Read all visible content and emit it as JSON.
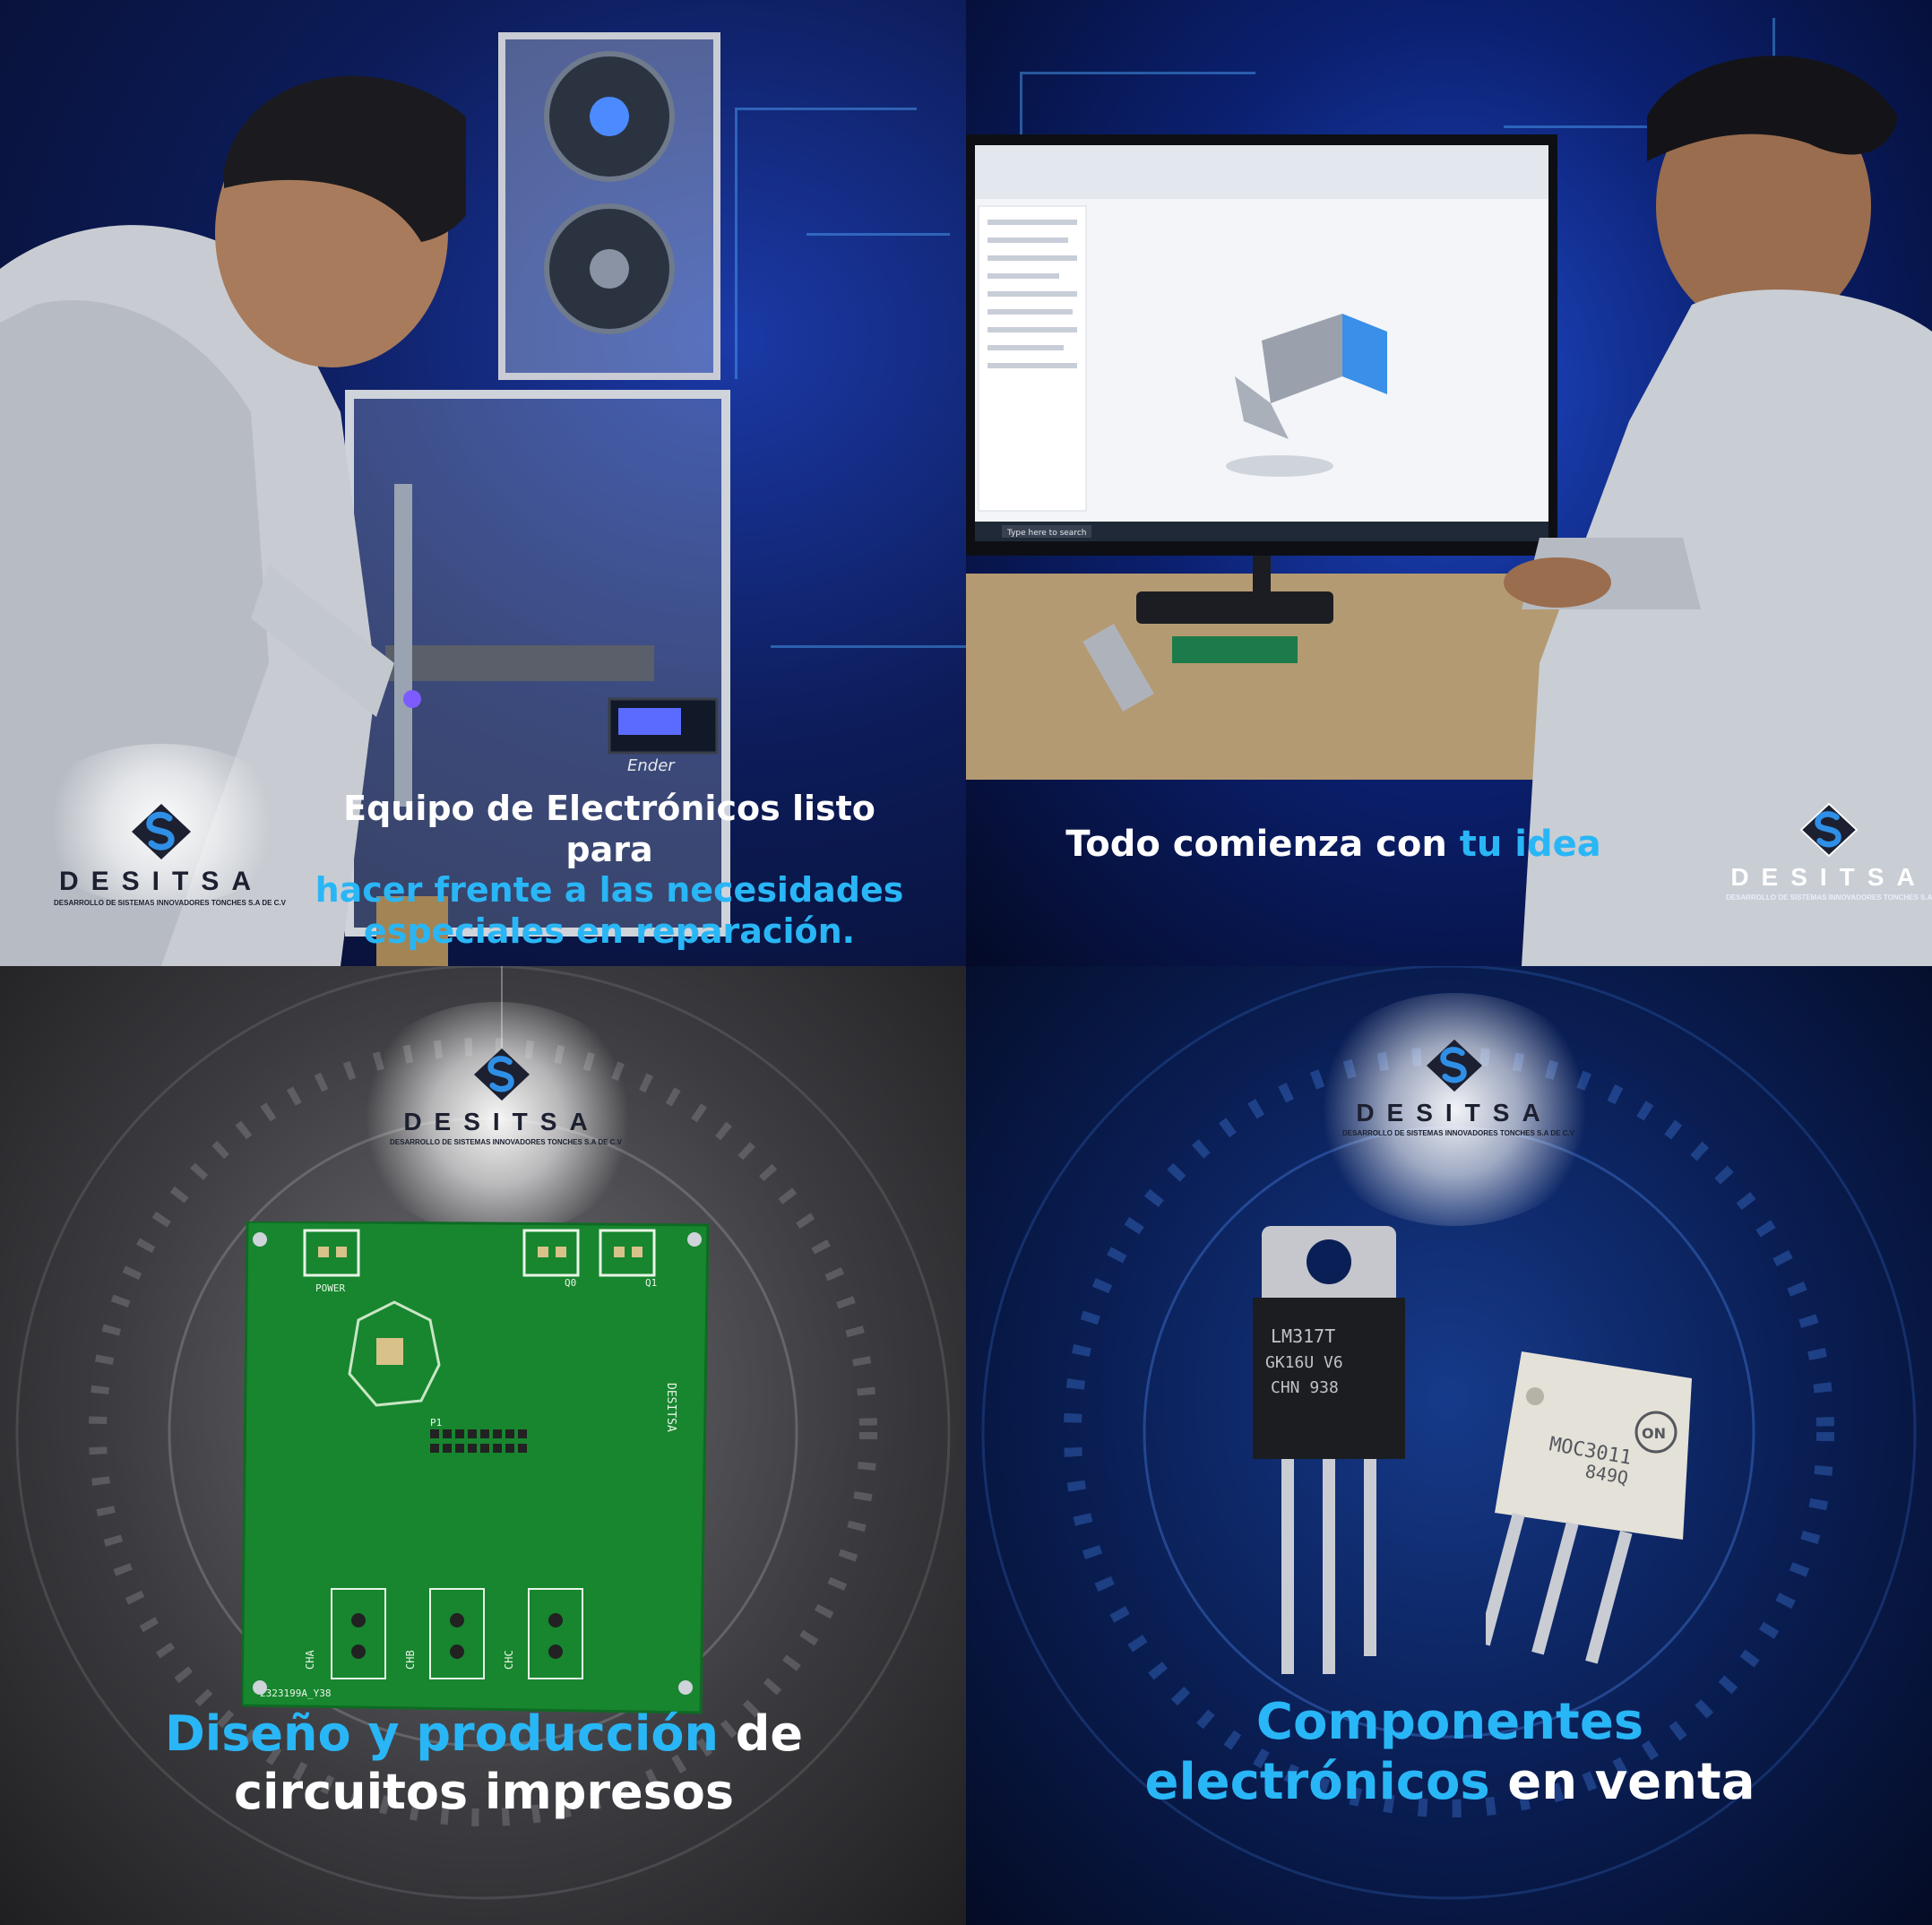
{
  "brand": {
    "name": "DESITSA",
    "tagline": "DESARROLLO DE SISTEMAS INNOVADORES TONCHES S.A DE C.V",
    "colors": {
      "accent": "#29b6f6",
      "text_light": "#ffffff",
      "logo_dark": "#1c2030"
    }
  },
  "panels": {
    "p1": {
      "caption_white_1": "Equipo de Electrónicos listo para",
      "caption_blue_2": "hacer frente a las necesidades",
      "caption_blue_3": "especiales en reparación.",
      "printer_brand": "Ender"
    },
    "p2": {
      "caption_white": "Todo comienza con ",
      "caption_blue": "tu idea",
      "taskbar_search": "Type here to search"
    },
    "p3": {
      "caption_blue": "Diseño y producción",
      "caption_white_1": " de",
      "caption_white_2": "circuitos impresos",
      "pcb": {
        "silk_power": "POWER",
        "silk_brand": "DESITSA",
        "silk_cha": "CHA",
        "silk_chb": "CHB",
        "silk_chc": "CHC",
        "silk_code": "2323199A_Y38",
        "silk_q0": "Q0",
        "silk_q1": "Q1",
        "silk_p1": "P1"
      }
    },
    "p4": {
      "caption_blue_1": "Componentes",
      "caption_blue_2": "electrónicos",
      "caption_white_2": " en venta",
      "regulator_lines": [
        "LM317T",
        "GK16U V6",
        "CHN 938"
      ],
      "opto_lines": [
        "MOC3011",
        "849Q"
      ],
      "opto_brand": "ON"
    }
  }
}
